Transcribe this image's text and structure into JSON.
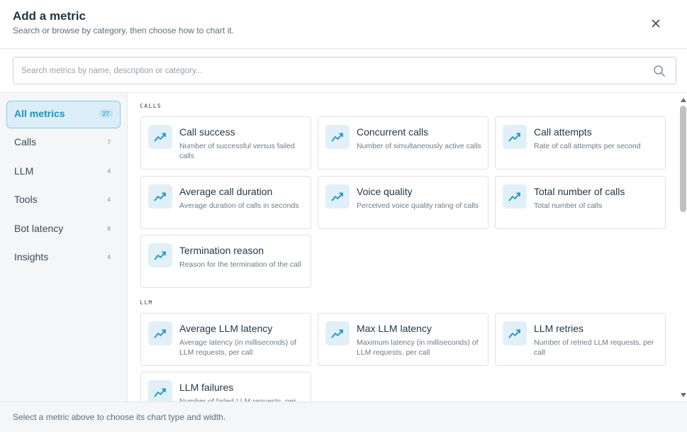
{
  "dialog": {
    "title": "Add a metric",
    "subtitle": "Search or browse by category, then choose how to chart it."
  },
  "search": {
    "placeholder": "Search metrics by name, description or category...",
    "value": ""
  },
  "sidebar": {
    "items": [
      {
        "label": "All metrics",
        "count": "27",
        "active": true
      },
      {
        "label": "Calls",
        "count": "7"
      },
      {
        "label": "LLM",
        "count": "4"
      },
      {
        "label": "Tools",
        "count": "4"
      },
      {
        "label": "Bot latency",
        "count": "8"
      },
      {
        "label": "Insights",
        "count": "4"
      }
    ]
  },
  "sections": [
    {
      "label": "CALLS",
      "cards": [
        {
          "title": "Call success",
          "desc": "Number of successful versus failed calls"
        },
        {
          "title": "Concurrent calls",
          "desc": "Number of simultaneously active calls"
        },
        {
          "title": "Call attempts",
          "desc": "Rate of call attempts per second"
        },
        {
          "title": "Average call duration",
          "desc": "Average duration of calls in seconds"
        },
        {
          "title": "Voice quality",
          "desc": "Perceived voice quality rating of calls"
        },
        {
          "title": "Total number of calls",
          "desc": "Total number of calls"
        },
        {
          "title": "Termination reason",
          "desc": "Reason for the termination of the call"
        }
      ]
    },
    {
      "label": "LLM",
      "cards": [
        {
          "title": "Average LLM latency",
          "desc": "Average latency (in milliseconds) of LLM requests, per call"
        },
        {
          "title": "Max LLM latency",
          "desc": "Maximum latency (in milliseconds) of LLM requests, per call"
        },
        {
          "title": "LLM retries",
          "desc": "Number of retried LLM requests, per call"
        },
        {
          "title": "LLM failures",
          "desc": "Number of failed LLM requests, per call"
        }
      ]
    }
  ],
  "footer": {
    "hint": "Select a metric above to choose its chart type and width."
  },
  "icons": {
    "close": "close-icon",
    "search": "search-icon",
    "metric": "trend-chart-icon"
  },
  "colors": {
    "accent": "#1a93c4",
    "accent_bg": "#dbeef7",
    "icon_bg": "#e1f0f8"
  }
}
